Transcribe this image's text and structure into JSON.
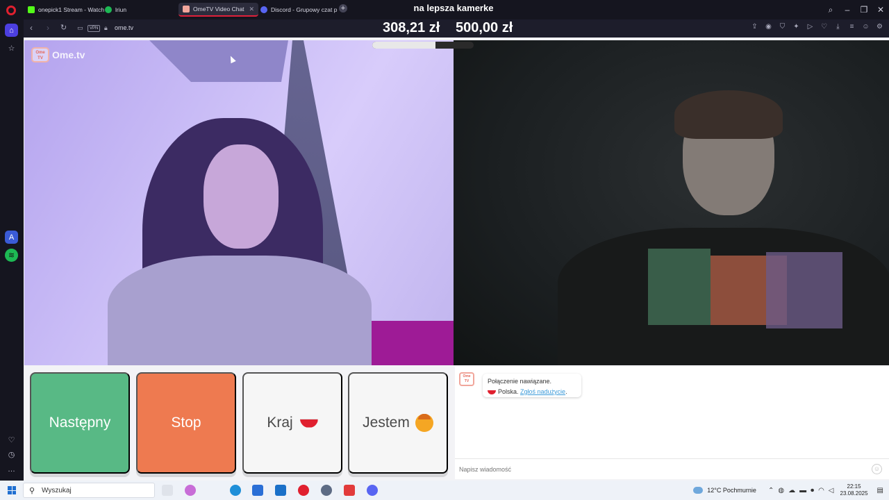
{
  "overlay": {
    "title": "na lepsza kamerke",
    "amount_current": "308,21 zł",
    "amount_goal": "500,00 zł",
    "progress_fraction": 0.62
  },
  "browser": {
    "tabs": [
      {
        "label": "onepick1 Stream - Watch",
        "color": "#53fc18"
      },
      {
        "label": "lriun",
        "color": "#1db954"
      },
      {
        "label": "OmeTV Video Chat",
        "color": "#f1a69b",
        "active": true
      },
      {
        "label": "Discord - Grupowy czat p",
        "color": "#5865f2"
      }
    ],
    "new_tab": "+",
    "vpn_label": "VPN",
    "url": "ome.tv"
  },
  "site": {
    "logo_small": "Ome TV",
    "logo_text": "Ome.tv",
    "buttons": {
      "next": "Następny",
      "stop": "Stop",
      "country": "Kraj",
      "iam": "Jestem"
    },
    "chat": {
      "status_line": "Połączenie nawiązane.",
      "country": "Polska.",
      "report_link": "Zgłoś nadużycie",
      "report_suffix": ".",
      "input_placeholder": "Napisz wiadomość"
    }
  },
  "taskbar": {
    "search_placeholder": "Wyszukaj",
    "weather_temp": "12°C",
    "weather_text": "Pochmurnie",
    "time": "22:15",
    "date": "23.08.2025"
  },
  "colors": {
    "next_button": "#58b985",
    "stop_button": "#ee7a50",
    "accent_red": "#e0202f"
  }
}
